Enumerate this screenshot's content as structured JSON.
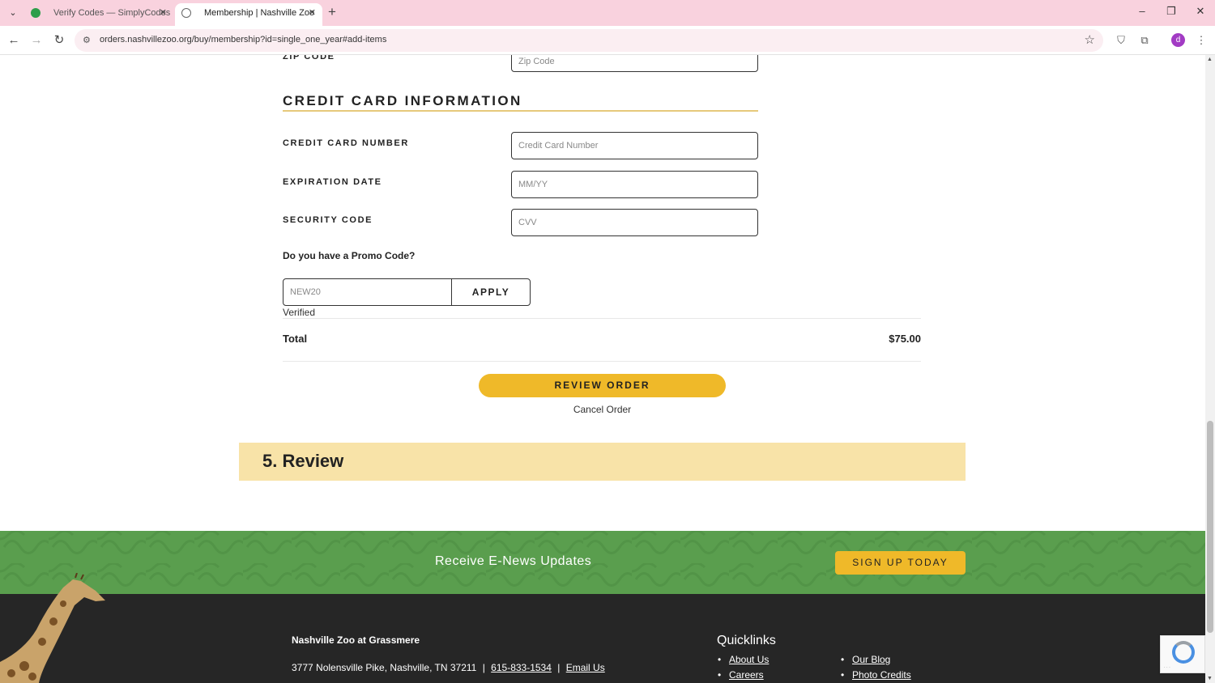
{
  "browser": {
    "tabs": [
      {
        "title": "Verify Codes — SimplyCodes",
        "active": false
      },
      {
        "title": "Membership | Nashville Zoo",
        "active": true
      }
    ],
    "url": "orders.nashvillezoo.org/buy/membership?id=single_one_year#add-items",
    "profile_initial": "d"
  },
  "form": {
    "zip_label": "ZIP CODE",
    "zip_placeholder": "Zip Code",
    "cc_section_title": "CREDIT CARD INFORMATION",
    "cc_number_label": "CREDIT CARD NUMBER",
    "cc_number_placeholder": "Credit Card Number",
    "exp_label": "EXPIRATION DATE",
    "exp_placeholder": "MM/YY",
    "cvv_label": "SECURITY CODE",
    "cvv_placeholder": "CVV",
    "promo_question": "Do you have a Promo Code?",
    "promo_value": "NEW20",
    "apply_label": "APPLY",
    "promo_status": "Verified",
    "total_label": "Total",
    "total_value": "$75.00",
    "review_button": "REVIEW ORDER",
    "cancel_link": "Cancel Order"
  },
  "review_section": {
    "title": "5. Review"
  },
  "news": {
    "text": "Receive E-News Updates",
    "signup_label": "SIGN UP TODAY"
  },
  "footer": {
    "org_name": "Nashville Zoo at Grassmere",
    "address": "3777 Nolensville Pike, Nashville, TN 37211",
    "separator": "|",
    "phone": "615-833-1534",
    "email_link": "Email Us",
    "quicklinks_title": "Quicklinks",
    "quicklinks": [
      "About Us",
      "Careers",
      "Our Blog",
      "Photo Credits"
    ]
  },
  "colors": {
    "accent_yellow": "#efb929",
    "banner": "#f8e3a8",
    "news_green": "#5a9e4e",
    "footer_dark": "#262626"
  }
}
